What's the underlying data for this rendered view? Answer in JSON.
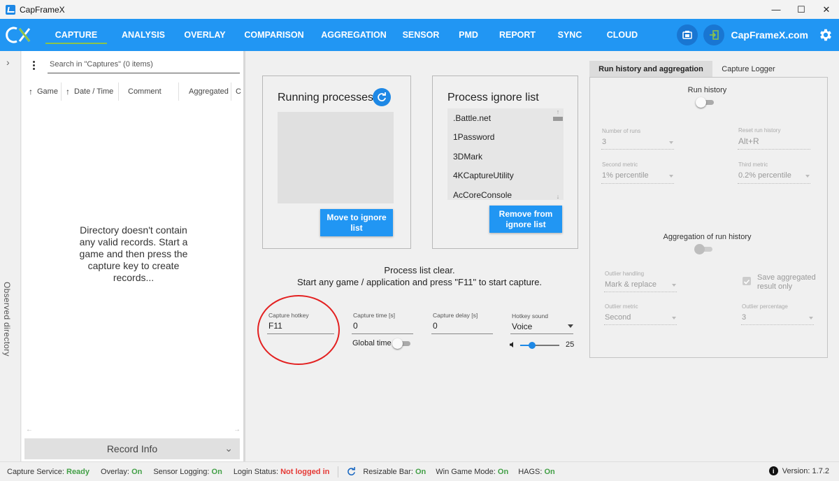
{
  "window": {
    "title": "CapFrameX",
    "minimize": "—",
    "maximize": "☐",
    "close": "✕"
  },
  "nav": {
    "items": [
      "CAPTURE",
      "ANALYSIS",
      "OVERLAY",
      "COMPARISON",
      "AGGREGATION",
      "SENSOR",
      "PMD",
      "REPORT",
      "SYNC",
      "CLOUD"
    ],
    "active": "CAPTURE",
    "site_link": "CapFrameX.com"
  },
  "left": {
    "observed_dir_label": "Observed directory",
    "search_placeholder": "Search in \"Captures\" (0 items)",
    "columns": [
      "Game",
      "Date / Time",
      "Comment",
      "Aggregated",
      "C"
    ],
    "empty_message": "Directory doesn't contain any valid records. Start a game and then press the capture key to create records...",
    "record_info": "Record Info"
  },
  "running": {
    "title": "Running processes",
    "move_button": "Move to ignore list"
  },
  "ignore": {
    "title": "Process ignore list",
    "items": [
      ".Battle.net",
      "1Password",
      "3DMark",
      "4KCaptureUtility",
      "AcCoreConsole"
    ],
    "remove_button": "Remove from ignore list"
  },
  "status_message": {
    "line1": "Process list clear.",
    "line2": "Start any game / application and press \"F11\" to start capture."
  },
  "capture": {
    "hotkey_label": "Capture hotkey",
    "hotkey_value": "F11",
    "time_label": "Capture time [s]",
    "time_value": "0",
    "delay_label": "Capture delay [s]",
    "delay_value": "0",
    "sound_label": "Hotkey sound",
    "sound_value": "Voice",
    "global_time_label": "Global time",
    "volume": "25"
  },
  "right": {
    "tabs": [
      "Run history and aggregation",
      "Capture Logger"
    ],
    "active_tab": "Run history and aggregation",
    "run_history_label": "Run history",
    "num_runs_label": "Number of runs",
    "num_runs_value": "3",
    "reset_label": "Reset run history",
    "reset_value": "Alt+R",
    "second_metric_label": "Second metric",
    "second_metric_value": "1% percentile",
    "third_metric_label": "Third metric",
    "third_metric_value": "0.2% percentile",
    "aggregation_label": "Aggregation of run history",
    "outlier_handling_label": "Outlier handling",
    "outlier_handling_value": "Mark & replace",
    "save_aggregated_label": "Save aggregated result only",
    "outlier_metric_label": "Outlier metric",
    "outlier_metric_value": "Second",
    "outlier_percentage_label": "Outlier percentage",
    "outlier_percentage_value": "3"
  },
  "statusbar": {
    "capture_service_label": "Capture Service:",
    "capture_service_value": "Ready",
    "overlay_label": "Overlay:",
    "overlay_value": "On",
    "sensor_label": "Sensor Logging:",
    "sensor_value": "On",
    "login_label": "Login Status:",
    "login_value": "Not logged in",
    "rebar_label": "Resizable Bar:",
    "rebar_value": "On",
    "wgm_label": "Win Game Mode:",
    "wgm_value": "On",
    "hags_label": "HAGS:",
    "hags_value": "On",
    "version_label": "Version:",
    "version_value": "1.7.2"
  },
  "colors": {
    "accent": "#2196f3",
    "nav_underline": "#8bc34a",
    "ok": "#43a047",
    "error": "#e53935",
    "annotation": "#e32020"
  },
  "icons": [
    "app-icon",
    "cx-logo",
    "refresh-icon",
    "screenshot-icon",
    "login-icon",
    "gear-icon",
    "volume-icon",
    "info-icon",
    "sync-icon",
    "chevron-right-icon",
    "chevron-down-icon",
    "kebab-menu-icon",
    "sort-up-icon"
  ]
}
